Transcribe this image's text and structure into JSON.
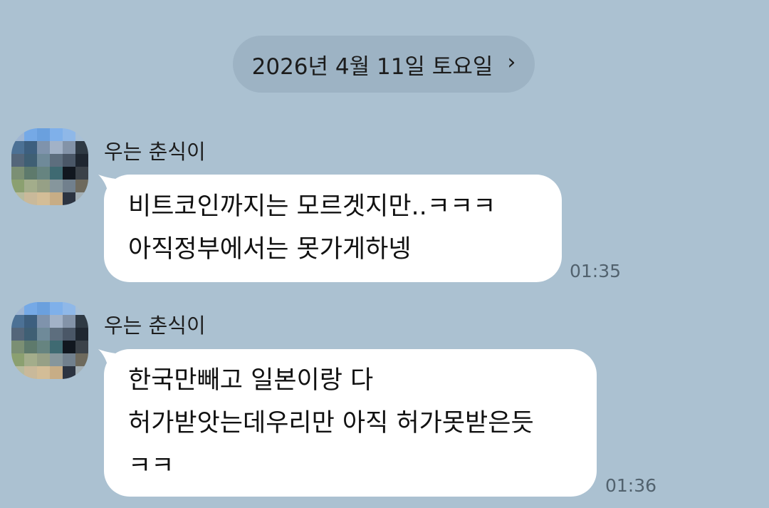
{
  "date_divider": {
    "label": "2026년 4월 11일 토요일",
    "chevron": "›"
  },
  "messages": [
    {
      "sender": "우는 춘식이",
      "lines": [
        "비트코인까지는 모르겟지만..ㅋㅋㅋ",
        "아직정부에서는 못가게하넹"
      ],
      "time": "01:35"
    },
    {
      "sender": "우는 춘식이",
      "lines": [
        "한국만빼고 일본이랑 다",
        "허가받앗는데우리만 아직 허가못받은듯",
        "ㅋㅋ"
      ],
      "time": "01:36"
    }
  ],
  "avatar_palette": [
    "#9fb6d3",
    "#75a9e6",
    "#6aa0de",
    "#7fb0ea",
    "#8fb8e8",
    "#a8c0d6",
    "#4c7195",
    "#3d5f7f",
    "#7f93ac",
    "#a2b2c7",
    "#8393a8",
    "#2f3a44",
    "#54667a",
    "#3f5f74",
    "#6f8a99",
    "#5d6e7e",
    "#4a5767",
    "#1f2731",
    "#7b8f74",
    "#5e7a6c",
    "#668480",
    "#3f6a72",
    "#11171f",
    "#3b4249",
    "#8ba070",
    "#a3ad8b",
    "#96a086",
    "#86969c",
    "#71808d",
    "#6e6a5d",
    "#b7bb9d",
    "#c9b99a",
    "#d3bd97",
    "#c7ad86",
    "#2c3441",
    "#a4b0b6"
  ]
}
